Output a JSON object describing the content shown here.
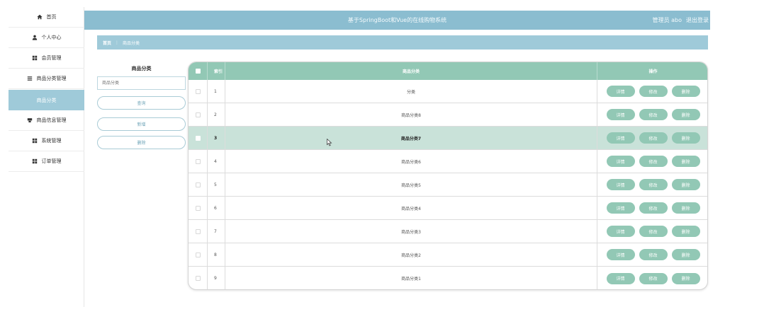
{
  "sidebar": {
    "items": [
      {
        "label": "首页",
        "icon": "home-icon"
      },
      {
        "label": "个人中心",
        "icon": "user-icon"
      },
      {
        "label": "会员管理",
        "icon": "grid-icon"
      },
      {
        "label": "商品分类管理",
        "icon": "list-icon"
      },
      {
        "label": "商品分类",
        "icon": ""
      },
      {
        "label": "商品信息管理",
        "icon": "goods-icon"
      },
      {
        "label": "系统管理",
        "icon": "grid-icon"
      },
      {
        "label": "订单管理",
        "icon": "grid-icon"
      }
    ]
  },
  "header": {
    "title": "基于SpringBoot和Vue的在线购物系统",
    "user": "管理员 abo",
    "logout": "退出登录"
  },
  "breadcrumb": {
    "home": "首页",
    "separator": "⋮",
    "current": "商品分类"
  },
  "search": {
    "title": "商品分类",
    "placeholder": "商品分类",
    "query_label": "查询",
    "add_label": "新增",
    "delete_label": "删除"
  },
  "table": {
    "headers": {
      "index": "索引",
      "name": "商品分类",
      "ops": "操作"
    },
    "ops": {
      "detail": "详情",
      "edit": "修改",
      "delete": "删除"
    },
    "rows": [
      {
        "index": "1",
        "name": "分类"
      },
      {
        "index": "2",
        "name": "商品分类8"
      },
      {
        "index": "3",
        "name": "商品分类7"
      },
      {
        "index": "4",
        "name": "商品分类6"
      },
      {
        "index": "5",
        "name": "商品分类5"
      },
      {
        "index": "6",
        "name": "商品分类4"
      },
      {
        "index": "7",
        "name": "商品分类3"
      },
      {
        "index": "8",
        "name": "商品分类2"
      },
      {
        "index": "9",
        "name": "商品分类1"
      }
    ]
  },
  "colors": {
    "accent": "#8bbdd0",
    "table_header": "#92c8b5",
    "highlight_row": "#c9e2d9"
  }
}
